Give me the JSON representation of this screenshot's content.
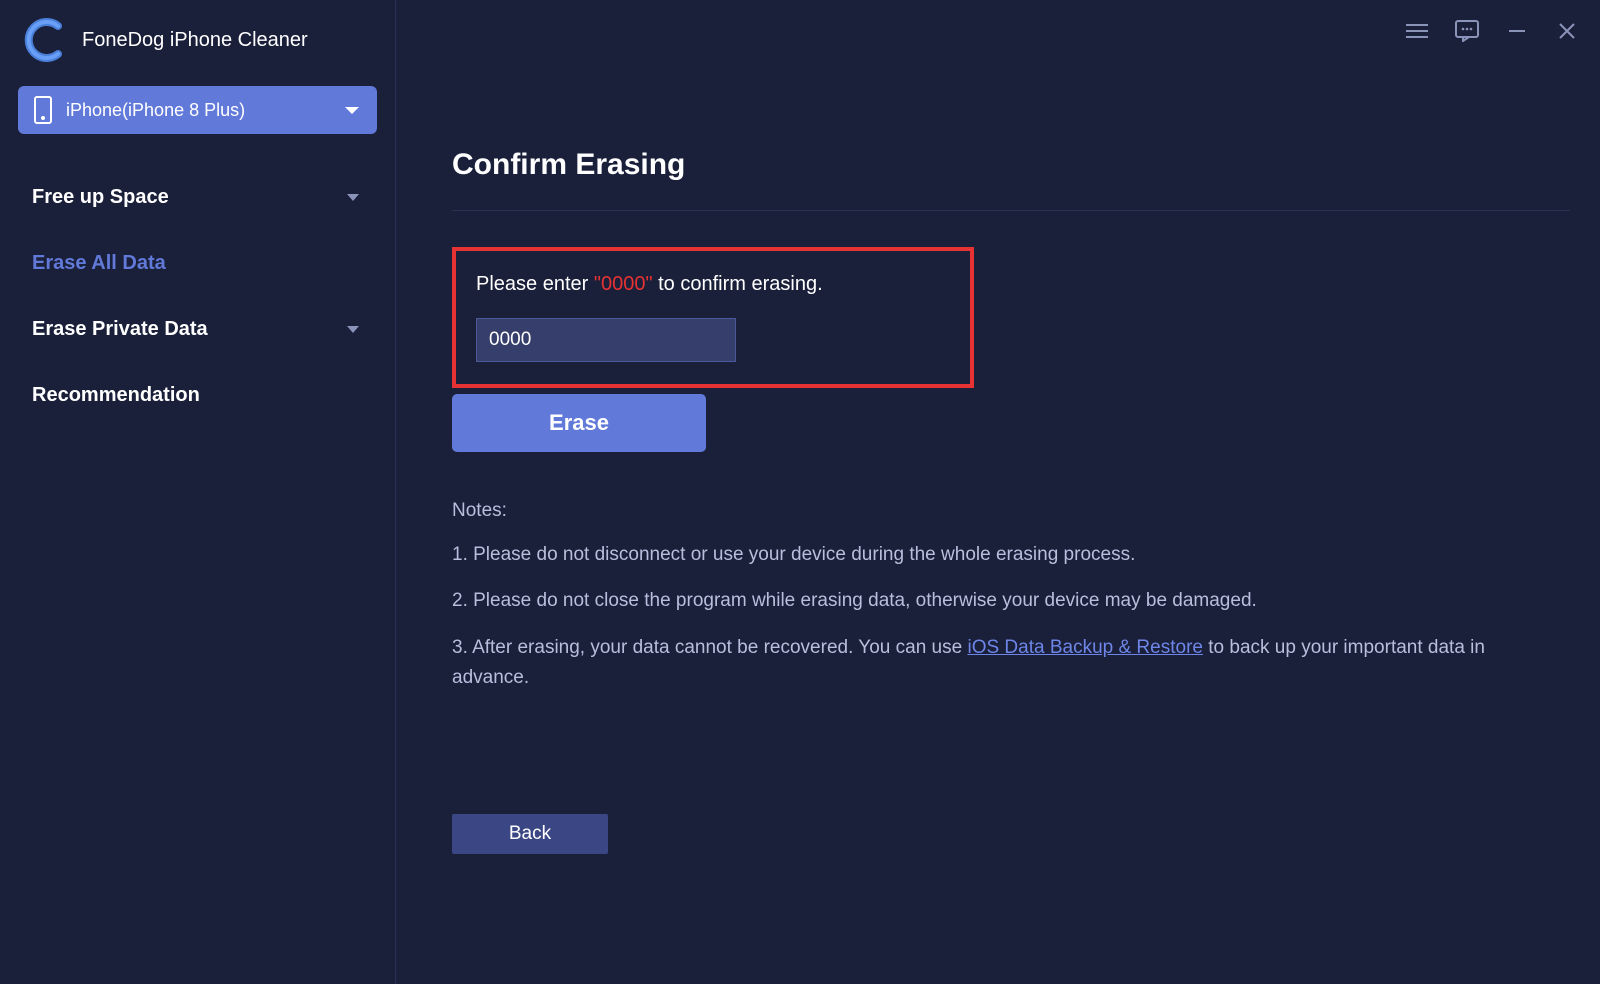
{
  "brand": {
    "name": "FoneDog iPhone Cleaner"
  },
  "device": {
    "label": "iPhone(iPhone 8 Plus)"
  },
  "sidebar": {
    "items": [
      {
        "label": "Free up Space",
        "has_chevron": true,
        "active": false
      },
      {
        "label": "Erase All Data",
        "has_chevron": false,
        "active": true
      },
      {
        "label": "Erase Private Data",
        "has_chevron": true,
        "active": false
      },
      {
        "label": "Recommendation",
        "has_chevron": false,
        "active": false
      }
    ]
  },
  "page": {
    "title": "Confirm Erasing",
    "prompt_prefix": "Please enter ",
    "prompt_code": "\"0000\"",
    "prompt_suffix": " to confirm erasing.",
    "input_value": "0000",
    "erase_label": "Erase",
    "notes_label": "Notes:",
    "note1": "1. Please do not disconnect or use your device during the whole erasing process.",
    "note2": "2. Please do not close the program while erasing data, otherwise your device may be damaged.",
    "note3_prefix": "3. After erasing, your data cannot be recovered. You can use ",
    "note3_link": "iOS Data Backup & Restore",
    "note3_suffix": " to back up your important data in advance.",
    "back_label": "Back"
  }
}
